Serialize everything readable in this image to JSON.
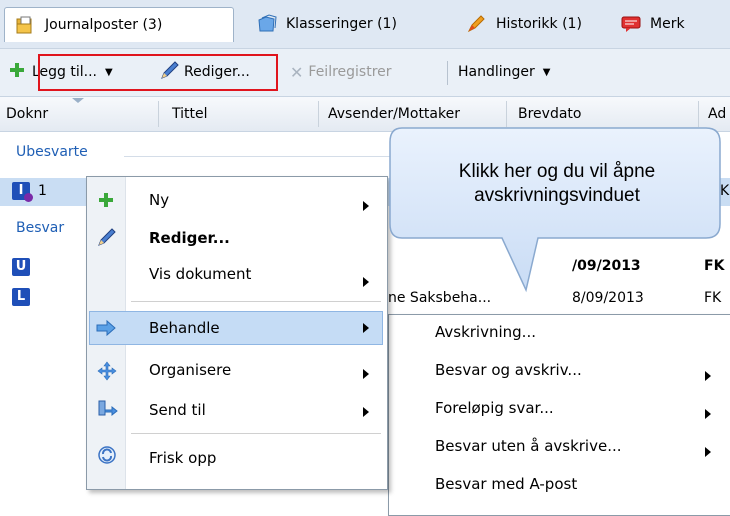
{
  "tabs": [
    {
      "label": "Journalposter (3)",
      "icon": "folder-document-icon"
    },
    {
      "label": "Klasseringer (1)",
      "icon": "folders-icon"
    },
    {
      "label": "Historikk (1)",
      "icon": "pencil-brush-icon"
    },
    {
      "label": "Merk",
      "icon": "comment-icon"
    }
  ],
  "toolbar": {
    "add_label": "Legg til...",
    "edit_label": "Rediger...",
    "error_label": "Feilregistrer",
    "actions_label": "Handlinger"
  },
  "columns": [
    "Doknr",
    "Tittel",
    "Avsender/Mottaker",
    "Brevdato",
    "Ad"
  ],
  "groups": {
    "unanswered": "Ubesvarte",
    "answered": "Besvar"
  },
  "rows": [
    {
      "badge": "I",
      "doknr": "1",
      "tail": "K"
    },
    {
      "badge": "U",
      "date": "/09/2013",
      "tail": "FK"
    },
    {
      "badge": "L",
      "sender": "ne Saksbeha...",
      "date": "8/09/2013",
      "tail": "FK"
    }
  ],
  "context_menu": {
    "items": [
      {
        "label": "Ny",
        "icon": "plus-icon",
        "submenu": true
      },
      {
        "label": "Rediger...",
        "icon": "pencil-icon",
        "submenu": false,
        "bold": true
      },
      {
        "label": "Vis dokument",
        "icon": "",
        "submenu": true
      },
      {
        "label": "Behandle",
        "icon": "process-arrow-icon",
        "submenu": true,
        "highlighted": true
      },
      {
        "label": "Organisere",
        "icon": "move-icon",
        "submenu": true
      },
      {
        "label": "Send til",
        "icon": "send-icon",
        "submenu": true
      },
      {
        "label": "Frisk opp",
        "icon": "refresh-icon",
        "submenu": false
      }
    ]
  },
  "submenu": {
    "items": [
      {
        "label": "Avskrivning...",
        "submenu": false
      },
      {
        "label": "Besvar og avskriv...",
        "submenu": true
      },
      {
        "label": "Foreløpig svar...",
        "submenu": true
      },
      {
        "label": "Besvar uten å avskrive...",
        "submenu": true
      },
      {
        "label": "Besvar med A-post",
        "submenu": false
      }
    ]
  },
  "callout": {
    "line1": "Klikk her og du vil åpne",
    "line2": "avskrivningsvinduet"
  },
  "colors": {
    "accent_red": "#e0141d",
    "badge_blue": "#1f4fb8",
    "group_blue": "#1f5fb5",
    "highlight": "#c5dcf5",
    "callout_bg": "#d8e7fa"
  }
}
